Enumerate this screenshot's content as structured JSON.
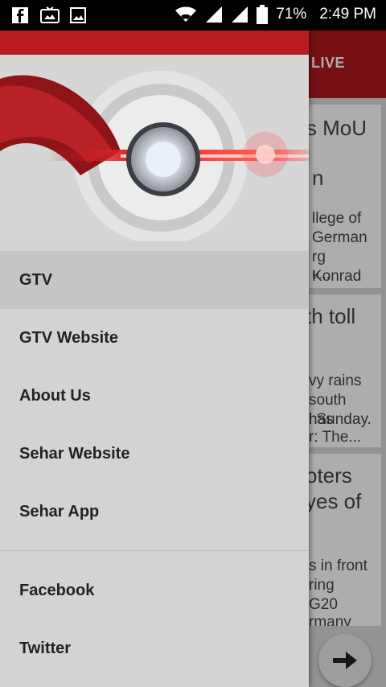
{
  "status_bar": {
    "icons_left": [
      "facebook-icon",
      "gallery-icon",
      "image-icon"
    ],
    "battery_percent": "71%",
    "time": "2:49 PM"
  },
  "background_screen": {
    "toolbar_live": "LIVE",
    "cards": [
      {
        "title_visible": "s MoU",
        "title_line2": "n",
        "body_lines": [
          "llege of",
          "German",
          "rg Konrad",
          "u..."
        ]
      },
      {
        "title_visible": "th toll",
        "body_lines": [
          "vy rains",
          "south has",
          "l Sunday.",
          "r: The..."
        ]
      },
      {
        "title_visible": "oters",
        "title_line2": "yes of",
        "body_lines": [
          "s in front",
          "ring",
          "G20",
          "rmany"
        ]
      }
    ]
  },
  "drawer": {
    "menu_group_1": [
      "GTV",
      "GTV Website",
      "About Us",
      "Sehar Website",
      "Sehar App"
    ],
    "menu_group_2": [
      "Facebook",
      "Twitter"
    ],
    "active_item": "GTV"
  },
  "colors": {
    "brand_red": "#b0181e",
    "drawer_bg": "#d3d3d3",
    "status_bar": "#000000"
  }
}
